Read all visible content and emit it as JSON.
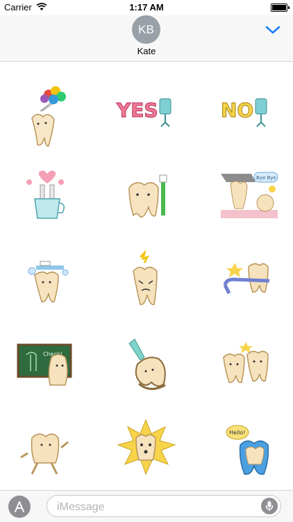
{
  "status_bar": {
    "carrier": "Carrier",
    "time": "1:17 AM"
  },
  "conversation": {
    "avatar_initials": "KB",
    "contact_name": "Kate"
  },
  "stickers": [
    {
      "icon": "tooth-balloons-icon"
    },
    {
      "icon": "yes-toothbrush-icon",
      "text": "YES"
    },
    {
      "icon": "no-toothbrush-icon",
      "text": "NO"
    },
    {
      "icon": "toothbrushes-cup-icon"
    },
    {
      "icon": "tooth-toothbrush-icon"
    },
    {
      "icon": "tooth-bye-bye-icon",
      "text": "Bye Bye"
    },
    {
      "icon": "tooth-brushing-icon"
    },
    {
      "icon": "tooth-pain-icon"
    },
    {
      "icon": "tooth-floss-icon"
    },
    {
      "icon": "tooth-check-board-icon",
      "text": "Check!"
    },
    {
      "icon": "tooth-drill-icon"
    },
    {
      "icon": "teeth-friends-icon"
    },
    {
      "icon": "tooth-running-icon"
    },
    {
      "icon": "tooth-shock-icon"
    },
    {
      "icon": "tooth-hello-icon",
      "text": "Hello!"
    }
  ],
  "composer": {
    "placeholder": "iMessage"
  }
}
